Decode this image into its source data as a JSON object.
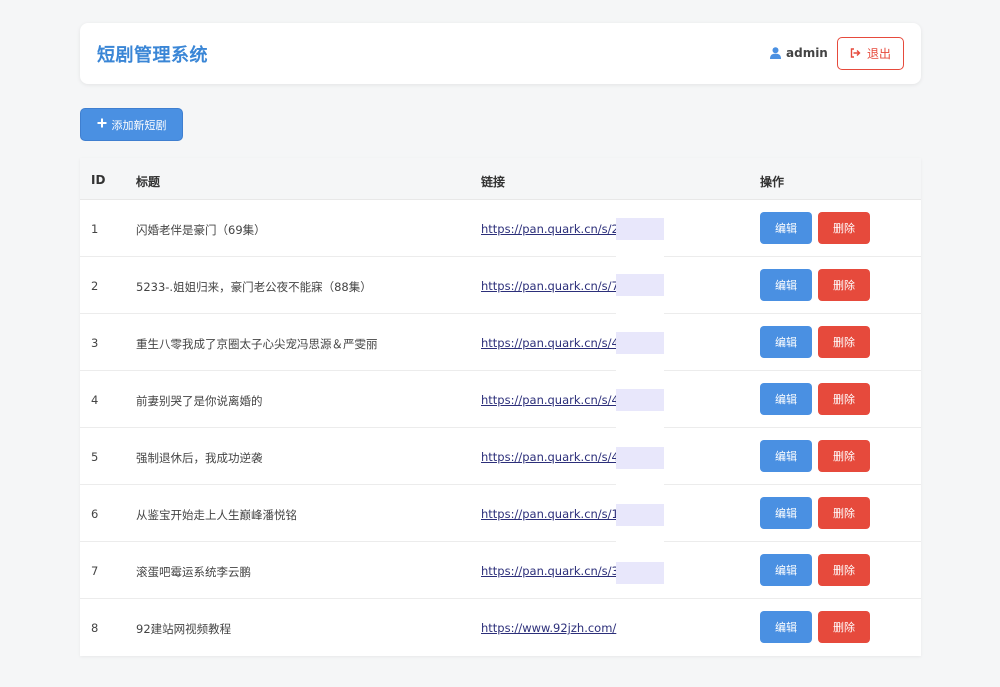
{
  "header": {
    "title": "短剧管理系统",
    "user": "admin",
    "logout_label": "退出"
  },
  "toolbar": {
    "add_label": "添加新短剧"
  },
  "table": {
    "columns": [
      "ID",
      "标题",
      "链接",
      "操作"
    ],
    "edit_label": "编辑",
    "delete_label": "删除",
    "rows": [
      {
        "id": "1",
        "title": "闪婚老伴是豪门（69集）",
        "link": "https://pan.quark.cn/s/251          0a"
      },
      {
        "id": "2",
        "title": "5233-.姐姐归来，豪门老公夜不能寐（88集）",
        "link": "https://pan.quark.cn/s/703          c7"
      },
      {
        "id": "3",
        "title": "重生八零我成了京圈太子心尖宠冯思源＆严雯丽",
        "link": "https://pan.quark.cn/s/439          2a"
      },
      {
        "id": "4",
        "title": "前妻别哭了是你说离婚的",
        "link": "https://pan.quark.cn/s/449          3"
      },
      {
        "id": "5",
        "title": "强制退休后，我成功逆袭",
        "link": "https://pan.quark.cn/s/418          99"
      },
      {
        "id": "6",
        "title": "从鉴宝开始走上人生巅峰潘悦铭",
        "link": "https://pan.quark.cn/s/108          0e"
      },
      {
        "id": "7",
        "title": "滚蛋吧霉运系统李云鹏",
        "link": "https://pan.quark.cn/s/3d9          f2"
      },
      {
        "id": "8",
        "title": "92建站网视频教程",
        "link": "https://www.92jzh.com/"
      }
    ]
  },
  "colors": {
    "primary": "#4a90e2",
    "danger": "#e64a3c",
    "title": "#3a86d6"
  }
}
